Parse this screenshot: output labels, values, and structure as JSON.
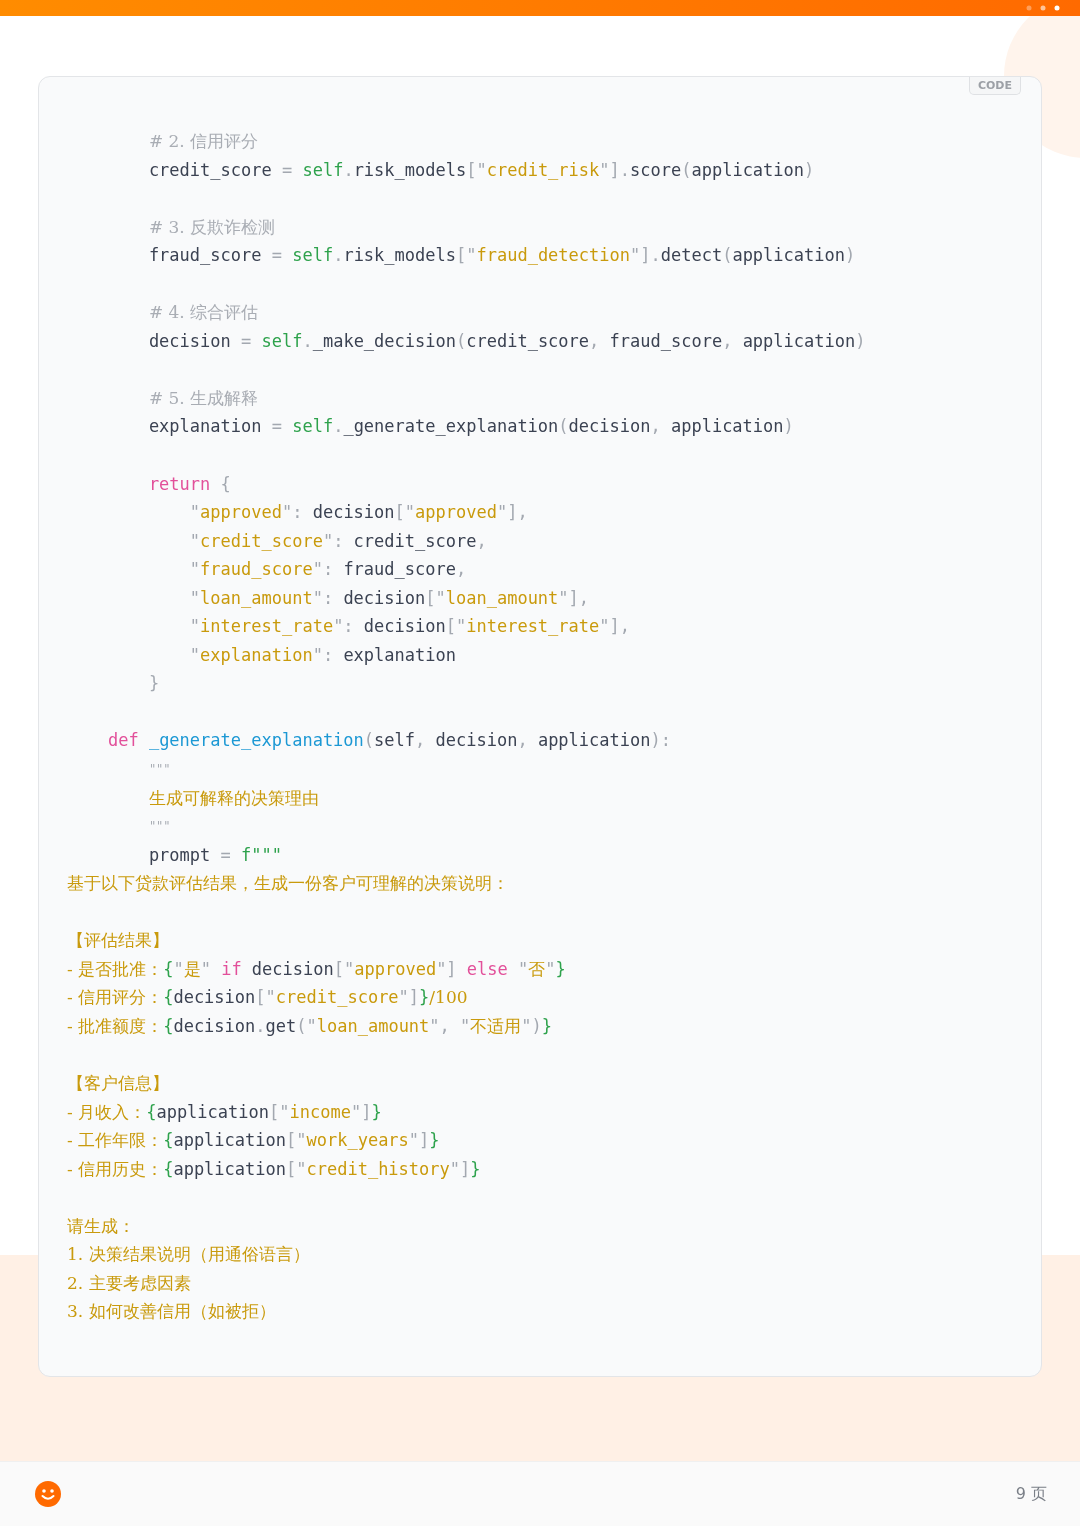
{
  "code_block": {
    "badge": "CODE",
    "lines": [
      {
        "kind": "body",
        "tokens": [
          {
            "kind": "comment",
            "text": "# 2. 信用评分"
          }
        ]
      },
      {
        "kind": "body",
        "tokens": [
          {
            "kind": "plain",
            "text": "credit_score"
          },
          {
            "kind": "punct",
            "text": " = "
          },
          {
            "kind": "self",
            "text": "self"
          },
          {
            "kind": "punct",
            "text": "."
          },
          {
            "kind": "plain",
            "text": "risk_models"
          },
          {
            "kind": "punct",
            "text": "[\""
          },
          {
            "kind": "string",
            "text": "credit_risk"
          },
          {
            "kind": "punct",
            "text": "\"]."
          },
          {
            "kind": "plain",
            "text": "score"
          },
          {
            "kind": "punct",
            "text": "("
          },
          {
            "kind": "plain",
            "text": "application"
          },
          {
            "kind": "punct",
            "text": ")"
          }
        ]
      },
      {
        "kind": "blank"
      },
      {
        "kind": "body",
        "tokens": [
          {
            "kind": "comment",
            "text": "# 3. 反欺诈检测"
          }
        ]
      },
      {
        "kind": "body",
        "tokens": [
          {
            "kind": "plain",
            "text": "fraud_score"
          },
          {
            "kind": "punct",
            "text": " = "
          },
          {
            "kind": "self",
            "text": "self"
          },
          {
            "kind": "punct",
            "text": "."
          },
          {
            "kind": "plain",
            "text": "risk_models"
          },
          {
            "kind": "punct",
            "text": "[\""
          },
          {
            "kind": "string",
            "text": "fraud_detection"
          },
          {
            "kind": "punct",
            "text": "\"]."
          },
          {
            "kind": "plain",
            "text": "detect"
          },
          {
            "kind": "punct",
            "text": "("
          },
          {
            "kind": "plain",
            "text": "application"
          },
          {
            "kind": "punct",
            "text": ")"
          }
        ]
      },
      {
        "kind": "blank"
      },
      {
        "kind": "body",
        "tokens": [
          {
            "kind": "comment",
            "text": "# 4. 综合评估"
          }
        ]
      },
      {
        "kind": "body",
        "tokens": [
          {
            "kind": "plain",
            "text": "decision"
          },
          {
            "kind": "punct",
            "text": " = "
          },
          {
            "kind": "self",
            "text": "self"
          },
          {
            "kind": "punct",
            "text": "."
          },
          {
            "kind": "plain",
            "text": "_make_decision"
          },
          {
            "kind": "punct",
            "text": "("
          },
          {
            "kind": "plain",
            "text": "credit_score"
          },
          {
            "kind": "punct",
            "text": ", "
          },
          {
            "kind": "plain",
            "text": "fraud_score"
          },
          {
            "kind": "punct",
            "text": ", "
          },
          {
            "kind": "plain",
            "text": "application"
          },
          {
            "kind": "punct",
            "text": ")"
          }
        ]
      },
      {
        "kind": "blank"
      },
      {
        "kind": "body",
        "tokens": [
          {
            "kind": "comment",
            "text": "# 5. 生成解释"
          }
        ]
      },
      {
        "kind": "body",
        "tokens": [
          {
            "kind": "plain",
            "text": "explanation"
          },
          {
            "kind": "punct",
            "text": " = "
          },
          {
            "kind": "self",
            "text": "self"
          },
          {
            "kind": "punct",
            "text": "."
          },
          {
            "kind": "plain",
            "text": "_generate_explanation"
          },
          {
            "kind": "punct",
            "text": "("
          },
          {
            "kind": "plain",
            "text": "decision"
          },
          {
            "kind": "punct",
            "text": ", "
          },
          {
            "kind": "plain",
            "text": "application"
          },
          {
            "kind": "punct",
            "text": ")"
          }
        ]
      },
      {
        "kind": "blank"
      },
      {
        "kind": "body",
        "tokens": [
          {
            "kind": "keyword",
            "text": "return"
          },
          {
            "kind": "punct",
            "text": " {"
          }
        ]
      },
      {
        "kind": "dict",
        "tokens": [
          {
            "kind": "punct",
            "text": "\""
          },
          {
            "kind": "string",
            "text": "approved"
          },
          {
            "kind": "punct",
            "text": "\": "
          },
          {
            "kind": "plain",
            "text": "decision"
          },
          {
            "kind": "punct",
            "text": "[\""
          },
          {
            "kind": "string",
            "text": "approved"
          },
          {
            "kind": "punct",
            "text": "\"],"
          }
        ]
      },
      {
        "kind": "dict",
        "tokens": [
          {
            "kind": "punct",
            "text": "\""
          },
          {
            "kind": "string",
            "text": "credit_score"
          },
          {
            "kind": "punct",
            "text": "\": "
          },
          {
            "kind": "plain",
            "text": "credit_score"
          },
          {
            "kind": "punct",
            "text": ","
          }
        ]
      },
      {
        "kind": "dict",
        "tokens": [
          {
            "kind": "punct",
            "text": "\""
          },
          {
            "kind": "string",
            "text": "fraud_score"
          },
          {
            "kind": "punct",
            "text": "\": "
          },
          {
            "kind": "plain",
            "text": "fraud_score"
          },
          {
            "kind": "punct",
            "text": ","
          }
        ]
      },
      {
        "kind": "dict",
        "tokens": [
          {
            "kind": "punct",
            "text": "\""
          },
          {
            "kind": "string",
            "text": "loan_amount"
          },
          {
            "kind": "punct",
            "text": "\": "
          },
          {
            "kind": "plain",
            "text": "decision"
          },
          {
            "kind": "punct",
            "text": "[\""
          },
          {
            "kind": "string",
            "text": "loan_amount"
          },
          {
            "kind": "punct",
            "text": "\"],"
          }
        ]
      },
      {
        "kind": "dict",
        "tokens": [
          {
            "kind": "punct",
            "text": "\""
          },
          {
            "kind": "string",
            "text": "interest_rate"
          },
          {
            "kind": "punct",
            "text": "\": "
          },
          {
            "kind": "plain",
            "text": "decision"
          },
          {
            "kind": "punct",
            "text": "[\""
          },
          {
            "kind": "string",
            "text": "interest_rate"
          },
          {
            "kind": "punct",
            "text": "\"],"
          }
        ]
      },
      {
        "kind": "dict",
        "tokens": [
          {
            "kind": "punct",
            "text": "\""
          },
          {
            "kind": "string",
            "text": "explanation"
          },
          {
            "kind": "punct",
            "text": "\": "
          },
          {
            "kind": "plain",
            "text": "explanation"
          }
        ]
      },
      {
        "kind": "body",
        "tokens": [
          {
            "kind": "punct",
            "text": "}"
          }
        ]
      },
      {
        "kind": "blank"
      },
      {
        "kind": "def",
        "tokens": [
          {
            "kind": "keyword",
            "text": "def "
          },
          {
            "kind": "func",
            "text": "_generate_explanation"
          },
          {
            "kind": "punct",
            "text": "("
          },
          {
            "kind": "plain",
            "text": "self"
          },
          {
            "kind": "punct",
            "text": ", "
          },
          {
            "kind": "plain",
            "text": "decision"
          },
          {
            "kind": "punct",
            "text": ", "
          },
          {
            "kind": "plain",
            "text": "application"
          },
          {
            "kind": "punct",
            "text": "):"
          }
        ]
      },
      {
        "kind": "body",
        "tokens": [
          {
            "kind": "quote",
            "text": "\"\"\""
          }
        ]
      },
      {
        "kind": "body",
        "tokens": [
          {
            "kind": "doc",
            "text": "生成可解释的决策理由"
          }
        ]
      },
      {
        "kind": "body",
        "tokens": [
          {
            "kind": "quote",
            "text": "\"\"\""
          }
        ]
      },
      {
        "kind": "body",
        "tokens": [
          {
            "kind": "plain",
            "text": "prompt"
          },
          {
            "kind": "punct",
            "text": " = "
          },
          {
            "kind": "self",
            "text": "f\"\"\""
          }
        ]
      },
      {
        "kind": "flush",
        "tokens": [
          {
            "kind": "doc",
            "text": "基于以下贷款评估结果，生成一份客户可理解的决策说明："
          }
        ]
      },
      {
        "kind": "blank"
      },
      {
        "kind": "flush",
        "tokens": [
          {
            "kind": "doc",
            "text": "【评估结果】"
          }
        ]
      },
      {
        "kind": "flush",
        "tokens": [
          {
            "kind": "doc",
            "text": "- 是否批准："
          },
          {
            "kind": "brace",
            "text": "{"
          },
          {
            "kind": "punct",
            "text": "\""
          },
          {
            "kind": "string",
            "text": "是"
          },
          {
            "kind": "punct",
            "text": "\" "
          },
          {
            "kind": "keyword",
            "text": "if"
          },
          {
            "kind": "plain",
            "text": " decision"
          },
          {
            "kind": "punct",
            "text": "[\""
          },
          {
            "kind": "string",
            "text": "approved"
          },
          {
            "kind": "punct",
            "text": "\"] "
          },
          {
            "kind": "keyword",
            "text": "else"
          },
          {
            "kind": "punct",
            "text": " \""
          },
          {
            "kind": "string",
            "text": "否"
          },
          {
            "kind": "punct",
            "text": "\""
          },
          {
            "kind": "brace",
            "text": "}"
          }
        ]
      },
      {
        "kind": "flush",
        "tokens": [
          {
            "kind": "doc",
            "text": "- 信用评分："
          },
          {
            "kind": "brace",
            "text": "{"
          },
          {
            "kind": "plain",
            "text": "decision"
          },
          {
            "kind": "punct",
            "text": "[\""
          },
          {
            "kind": "string",
            "text": "credit_score"
          },
          {
            "kind": "punct",
            "text": "\"]"
          },
          {
            "kind": "brace",
            "text": "}"
          },
          {
            "kind": "doc",
            "text": "/100"
          }
        ]
      },
      {
        "kind": "flush",
        "tokens": [
          {
            "kind": "doc",
            "text": "- 批准额度："
          },
          {
            "kind": "brace",
            "text": "{"
          },
          {
            "kind": "plain",
            "text": "decision"
          },
          {
            "kind": "punct",
            "text": "."
          },
          {
            "kind": "plain",
            "text": "get"
          },
          {
            "kind": "punct",
            "text": "(\""
          },
          {
            "kind": "string",
            "text": "loan_amount"
          },
          {
            "kind": "punct",
            "text": "\", \""
          },
          {
            "kind": "string",
            "text": "不适用"
          },
          {
            "kind": "punct",
            "text": "\")"
          },
          {
            "kind": "brace",
            "text": "}"
          }
        ]
      },
      {
        "kind": "blank"
      },
      {
        "kind": "flush",
        "tokens": [
          {
            "kind": "doc",
            "text": "【客户信息】"
          }
        ]
      },
      {
        "kind": "flush",
        "tokens": [
          {
            "kind": "doc",
            "text": "- 月收入："
          },
          {
            "kind": "brace",
            "text": "{"
          },
          {
            "kind": "plain",
            "text": "application"
          },
          {
            "kind": "punct",
            "text": "[\""
          },
          {
            "kind": "string",
            "text": "income"
          },
          {
            "kind": "punct",
            "text": "\"]"
          },
          {
            "kind": "brace",
            "text": "}"
          }
        ]
      },
      {
        "kind": "flush",
        "tokens": [
          {
            "kind": "doc",
            "text": "- 工作年限："
          },
          {
            "kind": "brace",
            "text": "{"
          },
          {
            "kind": "plain",
            "text": "application"
          },
          {
            "kind": "punct",
            "text": "[\""
          },
          {
            "kind": "string",
            "text": "work_years"
          },
          {
            "kind": "punct",
            "text": "\"]"
          },
          {
            "kind": "brace",
            "text": "}"
          }
        ]
      },
      {
        "kind": "flush",
        "tokens": [
          {
            "kind": "doc",
            "text": "- 信用历史："
          },
          {
            "kind": "brace",
            "text": "{"
          },
          {
            "kind": "plain",
            "text": "application"
          },
          {
            "kind": "punct",
            "text": "[\""
          },
          {
            "kind": "string",
            "text": "credit_history"
          },
          {
            "kind": "punct",
            "text": "\"]"
          },
          {
            "kind": "brace",
            "text": "}"
          }
        ]
      },
      {
        "kind": "blank"
      },
      {
        "kind": "flush",
        "tokens": [
          {
            "kind": "doc",
            "text": "请生成："
          }
        ]
      },
      {
        "kind": "flush",
        "tokens": [
          {
            "kind": "doc",
            "text": "1. 决策结果说明（用通俗语言）"
          }
        ]
      },
      {
        "kind": "flush",
        "tokens": [
          {
            "kind": "doc",
            "text": "2. 主要考虑因素"
          }
        ]
      },
      {
        "kind": "flush",
        "tokens": [
          {
            "kind": "doc",
            "text": "3. 如何改善信用（如被拒）"
          }
        ]
      }
    ]
  },
  "footer": {
    "page": "9 页"
  }
}
